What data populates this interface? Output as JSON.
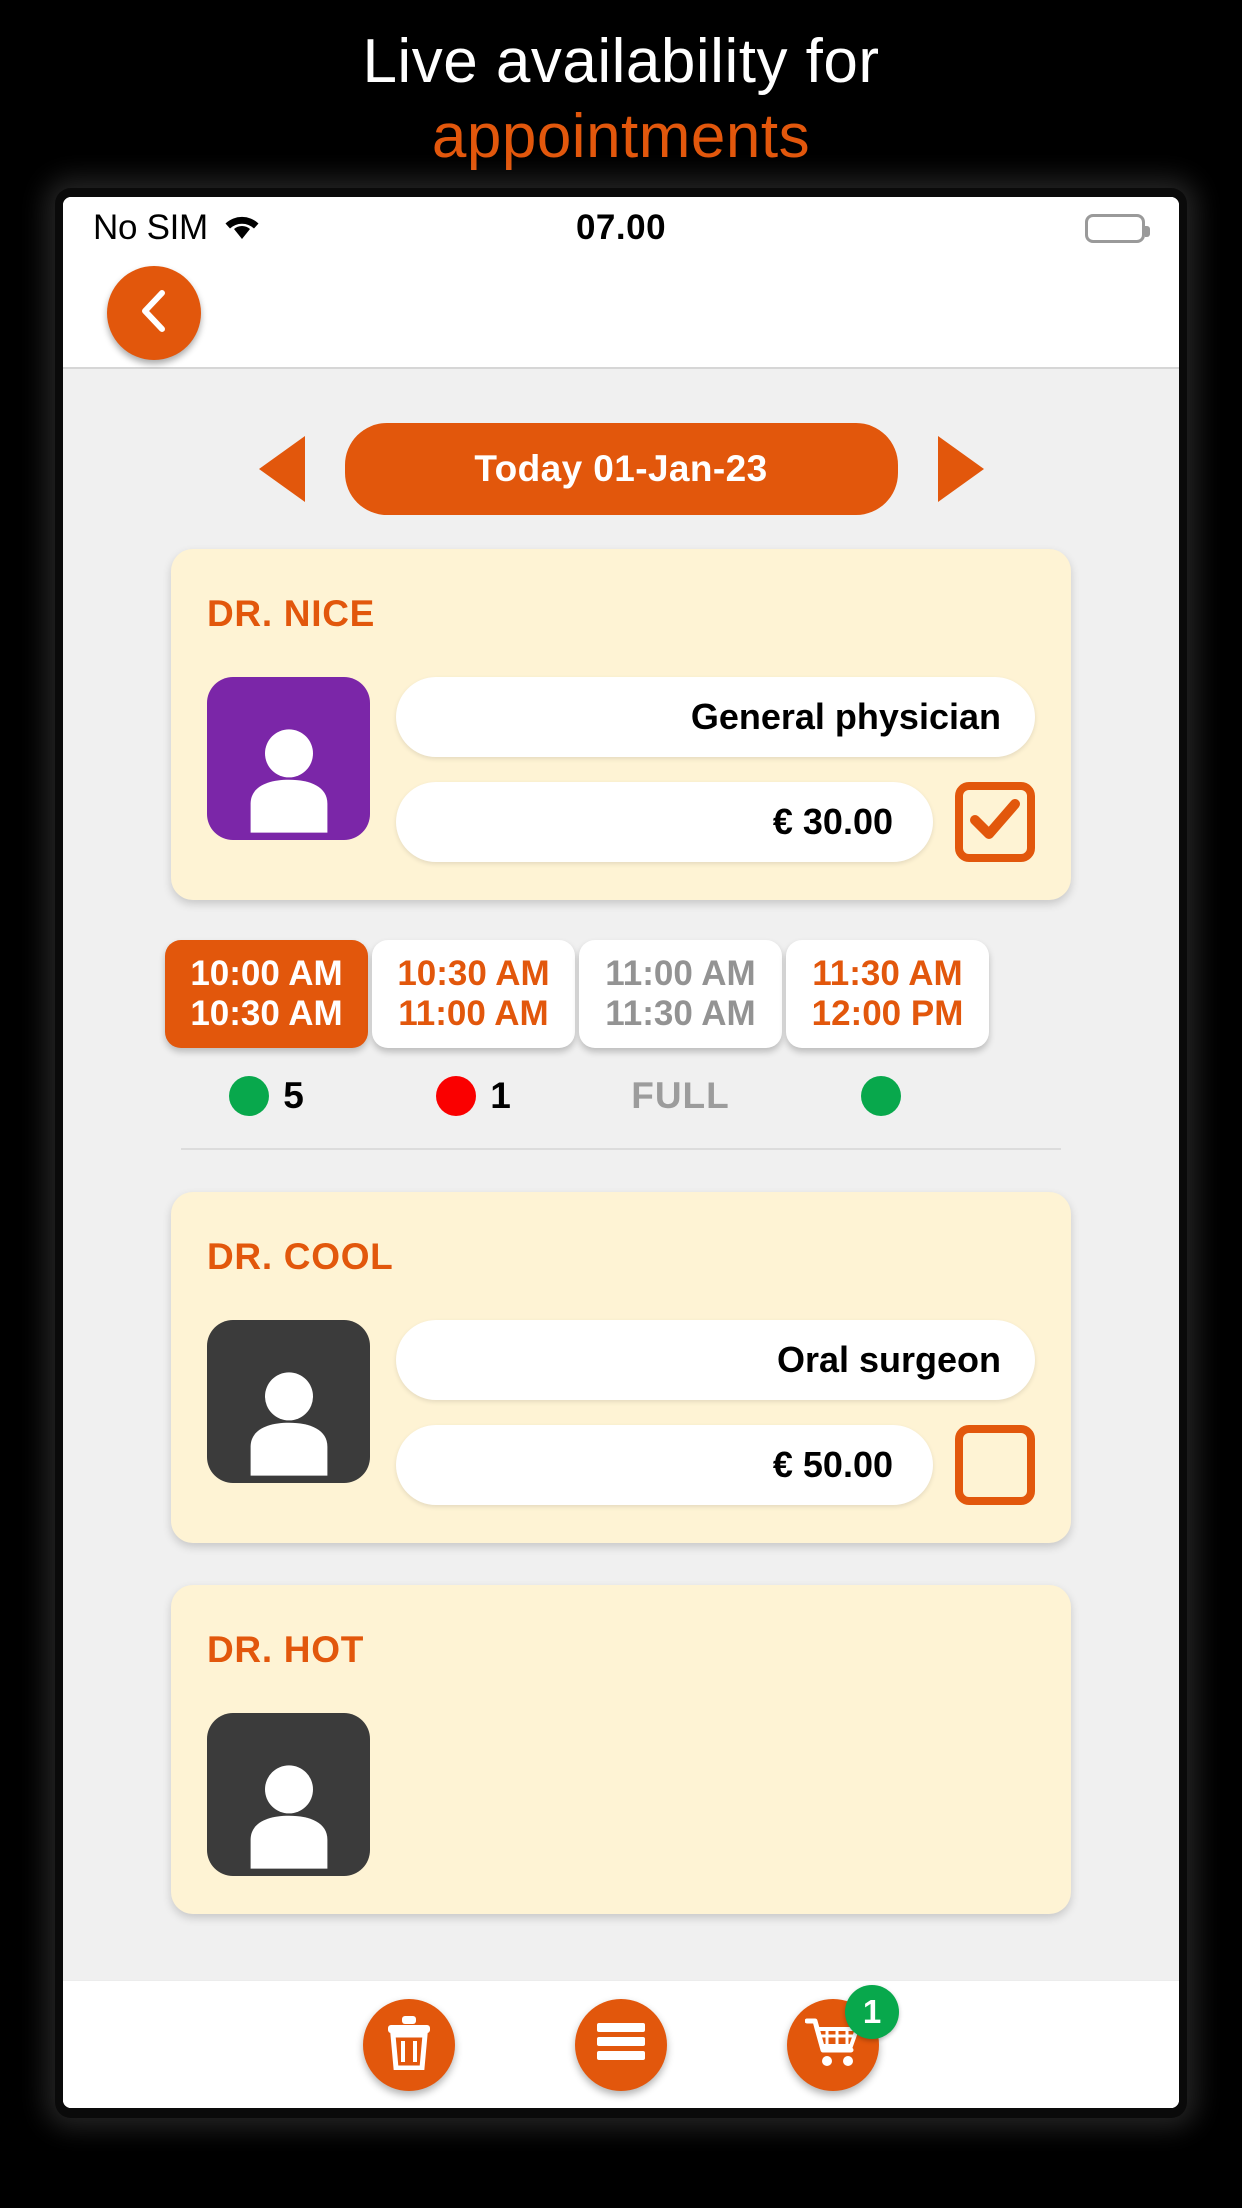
{
  "promo": {
    "line1": "Live availability for",
    "line2": "appointments",
    "accent_color": "#E2570C",
    "line1_color": "#FFFFFF"
  },
  "status_bar": {
    "carrier": "No SIM",
    "wifi_icon": "wifi-icon",
    "time": "07.00",
    "battery_icon": "battery-icon",
    "battery_level_percent": 75
  },
  "nav": {
    "back_icon": "chevron-left-icon"
  },
  "date_strip": {
    "prev_icon": "triangle-left-icon",
    "next_icon": "triangle-right-icon",
    "label": "Today 01-Jan-23"
  },
  "doctors": [
    {
      "name": "DR. NICE",
      "avatar_icon": "person-icon",
      "avatar_color": "#7B26A8",
      "specialty": "General physician",
      "price": "€ 30.00",
      "selected": true,
      "checkbox_icon": "check-icon",
      "slots": [
        {
          "start": "10:00 AM",
          "end": "10:30 AM",
          "state": "selected",
          "status_icon": "green-dot",
          "count": "5"
        },
        {
          "start": "10:30 AM",
          "end": "11:00 AM",
          "state": "available",
          "status_icon": "red-dot",
          "count": "1"
        },
        {
          "start": "11:00 AM",
          "end": "11:30 AM",
          "state": "full",
          "status_icon": "none",
          "count": "FULL"
        },
        {
          "start": "11:30 AM",
          "end": "12:00 PM",
          "state": "available",
          "status_icon": "green-dot",
          "count": ""
        }
      ]
    },
    {
      "name": "DR. COOL",
      "avatar_icon": "person-icon",
      "avatar_color": "#3B3B3B",
      "specialty": "Oral surgeon",
      "price": "€ 50.00",
      "selected": false,
      "checkbox_icon": "",
      "slots": []
    },
    {
      "name": "DR. HOT",
      "avatar_icon": "person-icon",
      "avatar_color": "#3B3B3B",
      "specialty": "",
      "price": "",
      "selected": false,
      "checkbox_icon": "",
      "slots": []
    }
  ],
  "bottom_nav": [
    {
      "icon": "trash-icon",
      "badge": ""
    },
    {
      "icon": "menu-icon",
      "badge": ""
    },
    {
      "icon": "cart-icon",
      "badge": "1"
    }
  ],
  "colors": {
    "accent": "#E2570C",
    "card": "#FEF3D4",
    "page": "#F0F0F0",
    "green": "#08A84C",
    "red": "#FA0000",
    "gray_text": "#939393"
  }
}
